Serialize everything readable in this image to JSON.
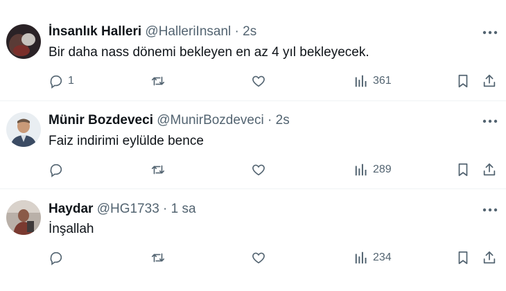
{
  "tweets": [
    {
      "display_name": "İnsanlık Halleri",
      "handle": "@HalleriInsanl",
      "separator": "·",
      "time": "2s",
      "text": "Bir daha nass dönemi bekleyen en az 4 yıl bekleyecek.",
      "reply_count": "1",
      "views": "361",
      "avatar_colors": [
        "#2a2226",
        "#7a2e2a",
        "#c7c2bd"
      ]
    },
    {
      "display_name": "Münir Bozdeveci",
      "handle": "@MunirBozdeveci",
      "separator": "·",
      "time": "2s",
      "text": "Faiz indirimi eylülde bence",
      "reply_count": "",
      "views": "289",
      "avatar_colors": [
        "#e9eef2",
        "#c99a78",
        "#3b4b63"
      ]
    },
    {
      "display_name": "Haydar",
      "handle": "@HG1733",
      "separator": "·",
      "time": "1 sa",
      "text": "İnşallah",
      "reply_count": "",
      "views": "234",
      "avatar_colors": [
        "#b9b0a8",
        "#7a3a30",
        "#3f3a3a"
      ]
    }
  ],
  "icons": {
    "reply": "reply-icon",
    "retweet": "retweet-icon",
    "like": "like-icon",
    "views": "views-icon",
    "bookmark": "bookmark-icon",
    "share": "share-icon",
    "more": "more-icon"
  },
  "colors": {
    "text_primary": "#0f1419",
    "text_secondary": "#536471",
    "divider": "#eff3f4",
    "background": "#ffffff"
  }
}
